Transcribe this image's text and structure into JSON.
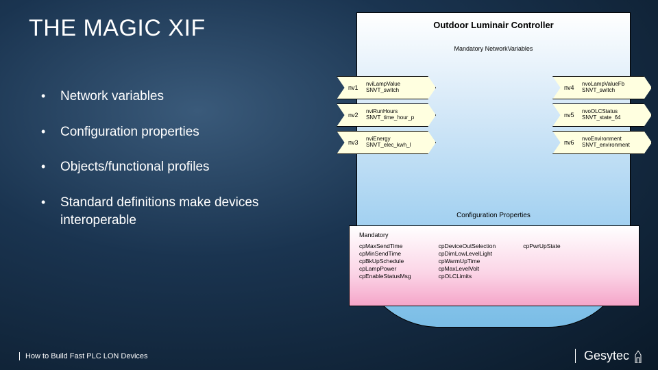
{
  "title": "THE MAGIC XIF",
  "bullets": [
    "Network variables",
    "Configuration properties",
    "Objects/functional profiles",
    "Standard definitions make devices interoperable"
  ],
  "footer": "How to Build Fast PLC LON Devices",
  "brand": "Gesytec",
  "diagram": {
    "profile_title": "Outdoor Luminair Controller",
    "mandatory_label": "Mandatory NetworkVariables",
    "nv_in": [
      {
        "id": "nv1",
        "name": "nviLampValue",
        "type": "SNVT_switch"
      },
      {
        "id": "nv2",
        "name": "nviRunHours",
        "type": "SNVT_time_hour_p"
      },
      {
        "id": "nv3",
        "name": "nviEnergy",
        "type": "SNVT_elec_kwh_l"
      }
    ],
    "nv_out": [
      {
        "id": "nv4",
        "name": "nvoLampValueFb",
        "type": "SNVT_switch"
      },
      {
        "id": "nv5",
        "name": "nvoOLCStatus",
        "type": "SNVT_state_64"
      },
      {
        "id": "nv6",
        "name": "nvoEnvironment",
        "type": "SNVT_environment"
      }
    ],
    "cp_label": "Configuration Properties",
    "cp_mandatory": "Mandatory",
    "cp_col1": [
      "cpMaxSendTime",
      "cpMinSendTime",
      "cpBkUpSchedule",
      "cpLampPower",
      "cpEnableStatusMsg"
    ],
    "cp_col2": [
      "cpDeviceOutSelection",
      "cpDimLowLevelLight",
      "cpWarmUpTime",
      "cpMaxLevelVolt",
      "cpOLCLimits"
    ],
    "cp_col3": [
      "cpPwrUpState"
    ]
  }
}
